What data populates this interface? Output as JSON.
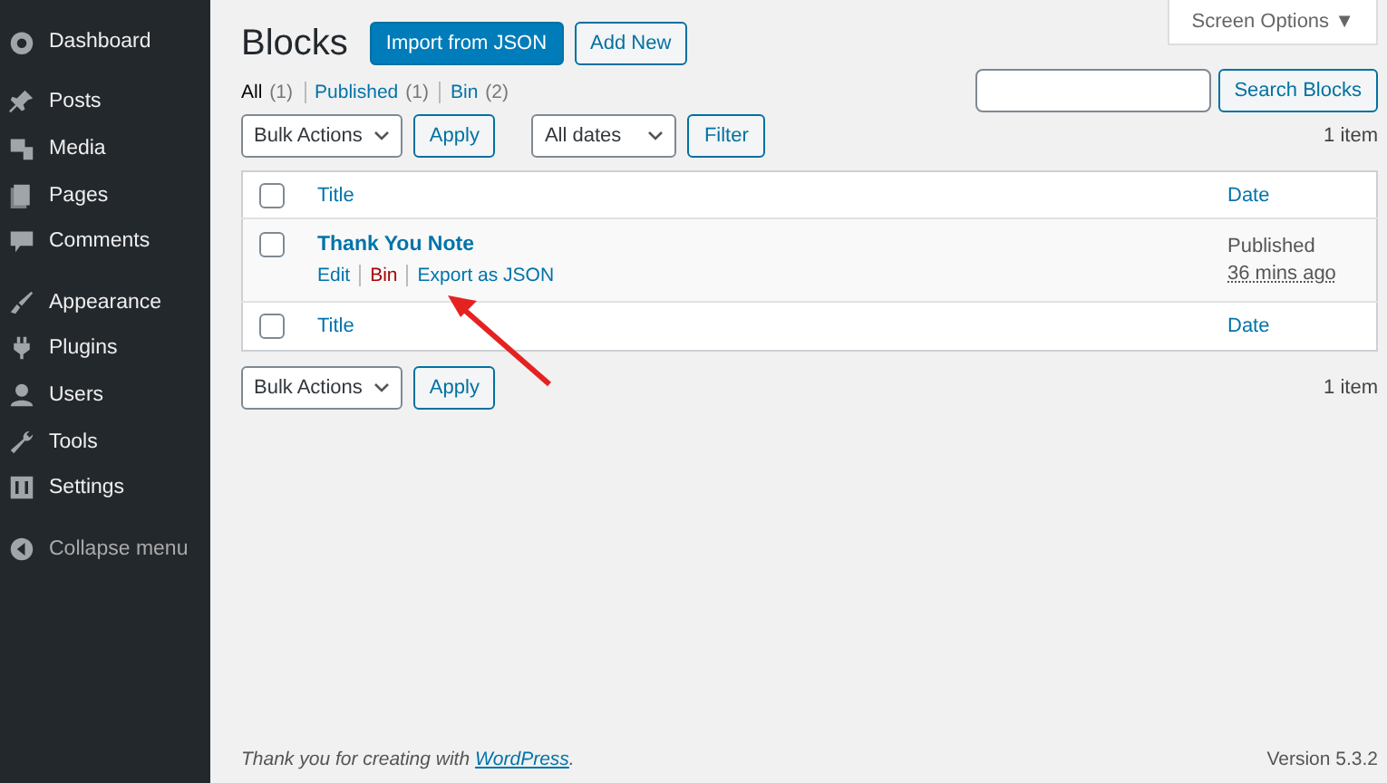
{
  "sidebar": {
    "groups": [
      [
        {
          "label": "Dashboard"
        }
      ],
      [
        {
          "label": "Posts"
        },
        {
          "label": "Media"
        },
        {
          "label": "Pages"
        },
        {
          "label": "Comments"
        }
      ],
      [
        {
          "label": "Appearance"
        },
        {
          "label": "Plugins"
        },
        {
          "label": "Users"
        },
        {
          "label": "Tools"
        },
        {
          "label": "Settings"
        }
      ]
    ],
    "collapse": "Collapse menu"
  },
  "screen_options": "Screen Options ▼",
  "page_title": "Blocks",
  "header_buttons": [
    {
      "label": "Import from JSON",
      "primary": true
    },
    {
      "label": "Add New",
      "primary": false
    }
  ],
  "views": [
    {
      "label": "All",
      "count": "(1)",
      "selected": true
    },
    {
      "label": "Published",
      "count": "(1)",
      "selected": false
    },
    {
      "label": "Bin",
      "count": "(2)",
      "selected": false
    }
  ],
  "search": {
    "button": "Search Blocks"
  },
  "top_nav": {
    "bulk": "Bulk Actions",
    "apply": "Apply",
    "dates": "All dates",
    "filter": "Filter",
    "count": "1 item"
  },
  "table": {
    "columns": [
      "Title",
      "Date"
    ],
    "header_checked": false,
    "footer_checked": false,
    "rows": [
      {
        "title": "Thank You Note",
        "actions": [
          {
            "label": "Edit",
            "kind": "normal"
          },
          {
            "label": "Bin",
            "kind": "delete"
          },
          {
            "label": "Export as JSON",
            "kind": "normal"
          }
        ],
        "status": "Published",
        "date": "36 mins ago",
        "checked": false
      }
    ],
    "footer_columns": [
      "Title",
      "Date"
    ]
  },
  "bottom_nav": {
    "bulk": "Bulk Actions",
    "apply": "Apply",
    "count": "1 item"
  },
  "footer": {
    "text_before": "Thank you for creating with ",
    "link": "WordPress",
    "text_after": ".",
    "version": "Version 5.3.2"
  }
}
